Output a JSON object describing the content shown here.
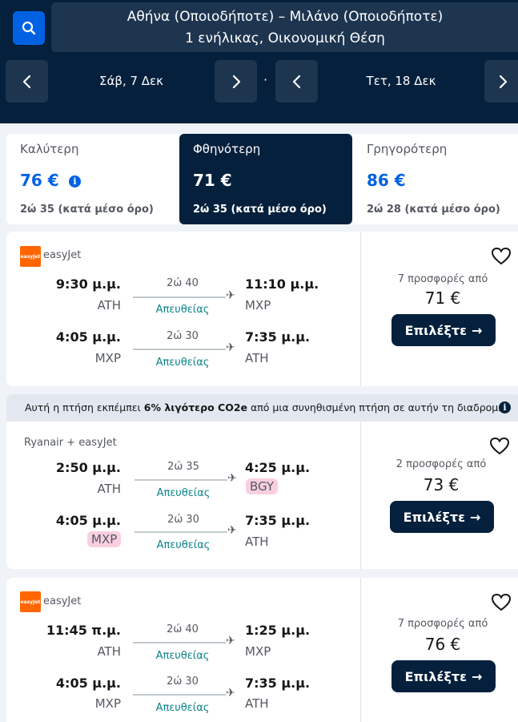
{
  "header": {
    "route": "Αθήνα (Οποιοδήποτε) – Μιλάνο (Οποιοδήποτε)",
    "passengers": "1 ενήλικας, Οικονομική Θέση",
    "outbound_date": "Σάβ, 7 Δεκ",
    "return_date": "Τετ, 18 Δεκ",
    "separator": "·"
  },
  "sort_tabs": [
    {
      "label": "Καλύτερη",
      "price": "76 €",
      "duration": "2ώ 35 (κατά μέσο όρο)"
    },
    {
      "label": "Φθηνότερη",
      "price": "71 €",
      "duration": "2ώ 35 (κατά μέσο όρο)"
    },
    {
      "label": "Γρηγορότερη",
      "price": "86 €",
      "duration": "2ώ 28 (κατά μέσο όρο)"
    }
  ],
  "eco_banner": {
    "prefix": "Αυτή η πτήση εκπέμπει ",
    "highlight": "6% λιγότερο CO2e",
    "suffix": " από μια συνηθισμένη πτήση σε αυτήν τη διαδρομή"
  },
  "results": [
    {
      "airline": "easyJet",
      "logo_text": "easyJet",
      "outbound": {
        "dep_time": "9:30 μ.μ.",
        "dep_code": "ATH",
        "duration": "2ώ 40",
        "stops": "Απευθείας",
        "arr_time": "11:10 μ.μ.",
        "arr_code": "MXP"
      },
      "inbound": {
        "dep_time": "4:05 μ.μ.",
        "dep_code": "MXP",
        "duration": "2ώ 30",
        "stops": "Απευθείας",
        "arr_time": "7:35 μ.μ.",
        "arr_code": "ATH"
      },
      "offers": "7 προσφορές από",
      "price": "71 €",
      "select_label": "Επιλέξτε"
    },
    {
      "airline": "Ryanair + easyJet",
      "outbound": {
        "dep_time": "2:50 μ.μ.",
        "dep_code": "ATH",
        "duration": "2ώ 35",
        "stops": "Απευθείας",
        "arr_time": "4:25 μ.μ.",
        "arr_code": "BGY"
      },
      "inbound": {
        "dep_time": "4:05 μ.μ.",
        "dep_code": "MXP",
        "duration": "2ώ 30",
        "stops": "Απευθείας",
        "arr_time": "7:35 μ.μ.",
        "arr_code": "ATH"
      },
      "offers": "2 προσφορές από",
      "price": "73 €",
      "select_label": "Επιλέξτε"
    },
    {
      "airline": "easyJet",
      "logo_text": "easyJet",
      "outbound": {
        "dep_time": "11:45 π.μ.",
        "dep_code": "ATH",
        "duration": "2ώ 40",
        "stops": "Απευθείας",
        "arr_time": "1:25 μ.μ.",
        "arr_code": "MXP"
      },
      "inbound": {
        "dep_time": "4:05 μ.μ.",
        "dep_code": "MXP",
        "duration": "2ώ 30",
        "stops": "Απευθείας",
        "arr_time": "7:35 μ.μ.",
        "arr_code": "ATH"
      },
      "offers": "7 προσφορές από",
      "price": "76 €",
      "select_label": "Επιλέξτε"
    }
  ],
  "colors": {
    "header_bg": "#05203c",
    "accent_blue": "#0062e3",
    "direct_teal": "#0c838a",
    "highlight_pink": "#f9cfe0",
    "easyjet_orange": "#ff6600"
  }
}
